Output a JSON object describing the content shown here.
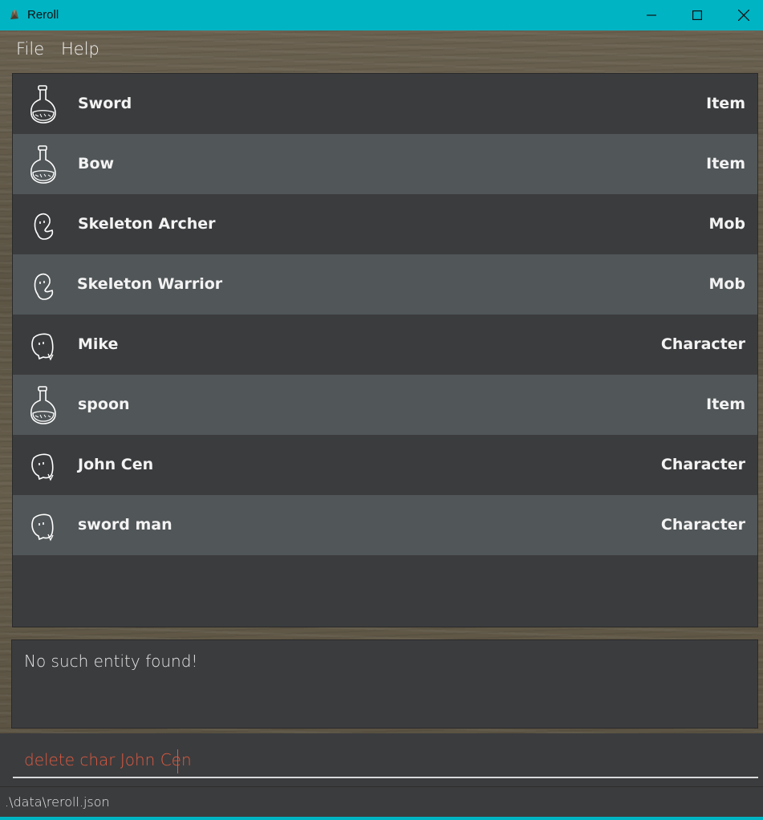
{
  "window": {
    "title": "Reroll",
    "controls": [
      "minimize-icon",
      "maximize-icon",
      "close-icon"
    ],
    "accent_color": "#00b4c4"
  },
  "menu": {
    "items": [
      {
        "label": "File"
      },
      {
        "label": "Help"
      }
    ]
  },
  "entities": [
    {
      "name": "Sword",
      "type": "Item",
      "icon": "potion-icon"
    },
    {
      "name": "Bow",
      "type": "Item",
      "icon": "potion-icon"
    },
    {
      "name": "Skeleton Archer",
      "type": "Mob",
      "icon": "ghost-icon"
    },
    {
      "name": "Skeleton Warrior",
      "type": "Mob",
      "icon": "ghost-icon"
    },
    {
      "name": "Mike",
      "type": "Character",
      "icon": "character-icon"
    },
    {
      "name": "spoon",
      "type": "Item",
      "icon": "potion-icon"
    },
    {
      "name": "John Cen",
      "type": "Character",
      "icon": "character-icon"
    },
    {
      "name": "sword man",
      "type": "Character",
      "icon": "character-icon"
    }
  ],
  "result": {
    "message": "No such entity found!"
  },
  "command": {
    "value": "delete char John Cen",
    "text_color": "#e05a40"
  },
  "status": {
    "file_path": ".\\data\\reroll.json"
  }
}
